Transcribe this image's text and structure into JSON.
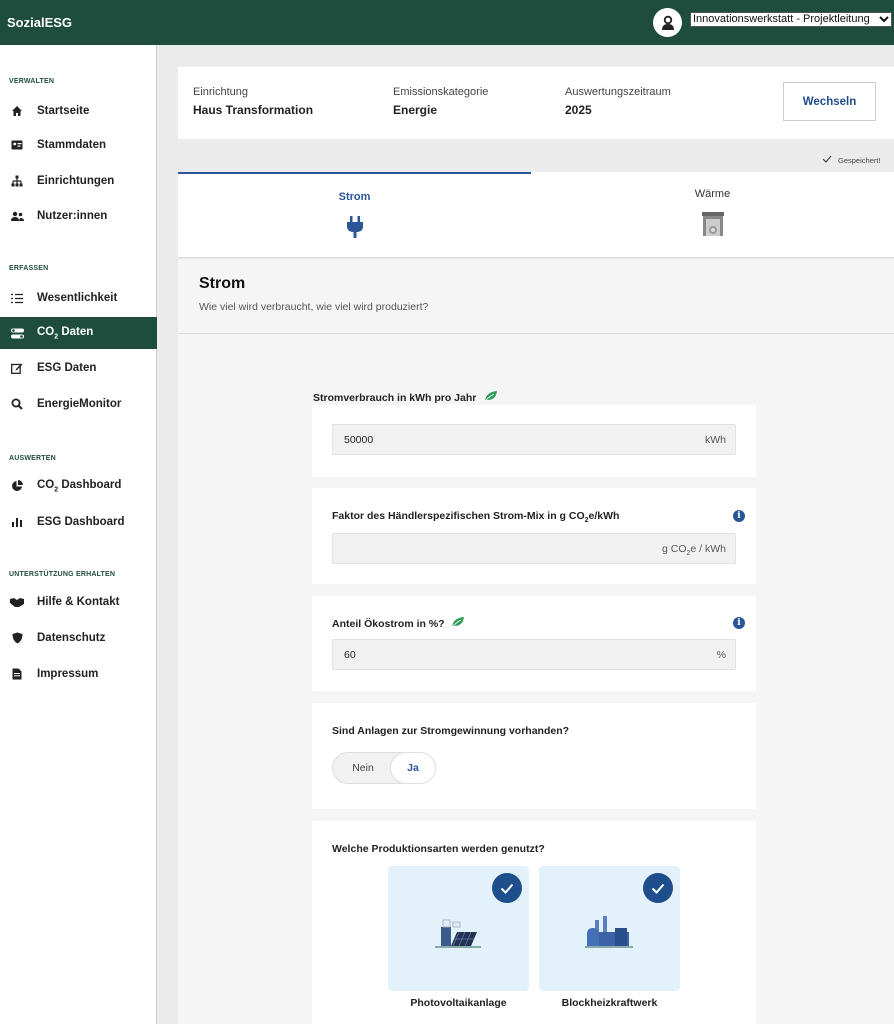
{
  "app": {
    "brand": "SozialESG"
  },
  "user": {
    "account_select": "Innovationswerkstatt - Projektleitung"
  },
  "sidebar": {
    "sections": [
      {
        "title": "VERWALTEN"
      },
      {
        "title": "ERFASSEN"
      },
      {
        "title": "AUSWERTEN"
      },
      {
        "title": "UNTERSTÜTZUNG ERHALTEN"
      }
    ],
    "items": [
      {
        "label": "Startseite",
        "icon": "home-icon"
      },
      {
        "label": "Stammdaten",
        "icon": "id-card-icon"
      },
      {
        "label": "Einrichtungen",
        "icon": "sitemap-icon"
      },
      {
        "label": "Nutzer:innen",
        "icon": "users-icon"
      },
      {
        "label": "Wesentlichkeit",
        "icon": "list-icon"
      },
      {
        "label_main": "CO",
        "label_sub": "2",
        "label_end": " Daten",
        "icon": "toggle-icon",
        "active": true
      },
      {
        "label": "ESG Daten",
        "icon": "edit-icon"
      },
      {
        "label": "EnergieMonitor",
        "icon": "search-icon"
      },
      {
        "label_main": "CO",
        "label_sub": "2",
        "label_end": " Dashboard",
        "icon": "pie-chart-icon"
      },
      {
        "label": "ESG Dashboard",
        "icon": "bar-chart-icon"
      },
      {
        "label": "Hilfe & Kontakt",
        "icon": "handshake-icon"
      },
      {
        "label": "Datenschutz",
        "icon": "shield-icon"
      },
      {
        "label": "Impressum",
        "icon": "document-icon"
      }
    ]
  },
  "header": {
    "facility_label": "Einrichtung",
    "facility_value": "Haus Transformation",
    "category_label": "Emissionskategorie",
    "category_value": "Energie",
    "period_label": "Auswertungszeitraum",
    "period_value": "2025",
    "switch_button": "Wechseln"
  },
  "status": {
    "saved": "Gespeichert!"
  },
  "tabs": [
    {
      "label": "Strom",
      "icon": "plug-icon",
      "active": true
    },
    {
      "label": "Wärme",
      "icon": "furnace-icon",
      "active": false
    }
  ],
  "section": {
    "title": "Strom",
    "subtitle": "Wie viel wird verbraucht, wie viel wird produziert?"
  },
  "fields": {
    "consumption": {
      "label": "Stromverbrauch in kWh pro Jahr",
      "value": "50000",
      "unit": "kWh"
    },
    "mix_factor": {
      "label_a": "Faktor des Händlerspezifischen Strom-Mix in g CO",
      "label_sub": "2",
      "label_b": "e/kWh",
      "value": "",
      "unit_a": "g CO",
      "unit_sub": "2",
      "unit_b": "e / kWh"
    },
    "green_share": {
      "label": "Anteil Ökostrom in %?",
      "value": "60",
      "unit": "%"
    },
    "generation": {
      "label": "Sind Anlagen zur Stromgewinnung vorhanden?",
      "option_no": "Nein",
      "option_yes": "Ja",
      "selected": "Ja"
    },
    "production": {
      "label": "Welche Produktionsarten werden genutzt?",
      "options": [
        {
          "label": "Photovoltaikanlage",
          "checked": true
        },
        {
          "label": "Blockheizkraftwerk",
          "checked": true
        }
      ]
    }
  },
  "colors": {
    "brand_green": "#1e4d3d",
    "accent_blue": "#2a5599",
    "leaf_green": "#2e9e5a",
    "tile_bg": "#e3f1fb"
  }
}
